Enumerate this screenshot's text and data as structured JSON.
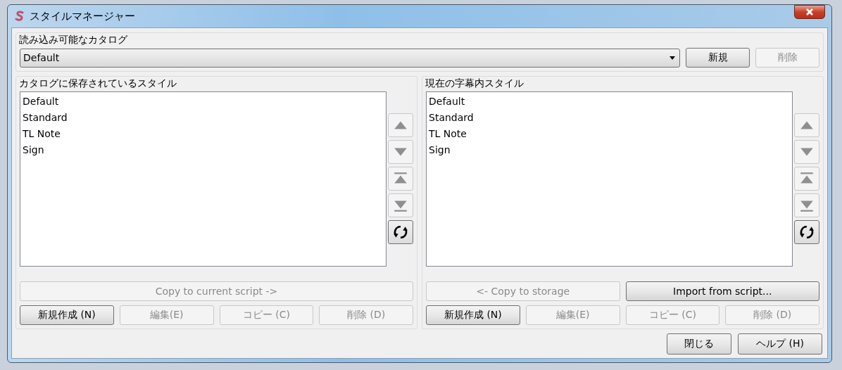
{
  "window": {
    "title": "スタイルマネージャー"
  },
  "catalog": {
    "label": "読み込み可能なカタログ",
    "value": "Default",
    "buttons": [
      {
        "label": "新規",
        "disabled": false
      },
      {
        "label": "削除",
        "disabled": true
      }
    ]
  },
  "panels": [
    {
      "title": "カタログに保存されているスタイル",
      "items": [
        "Default",
        "Standard",
        "TL Note",
        "Sign"
      ],
      "move_buttons": [
        {
          "kind": "up",
          "disabled": true
        },
        {
          "kind": "down",
          "disabled": true
        },
        {
          "kind": "top",
          "disabled": true
        },
        {
          "kind": "bottom",
          "disabled": true
        },
        {
          "kind": "refresh",
          "disabled": false
        }
      ],
      "transfer_buttons": [
        {
          "label": "Copy to current script ->",
          "disabled": true
        }
      ],
      "buttons": [
        {
          "label": "新規作成 (N)",
          "disabled": false
        },
        {
          "label": "編集(E)",
          "disabled": true
        },
        {
          "label": "コピー (C)",
          "disabled": true
        },
        {
          "label": "削除 (D)",
          "disabled": true
        }
      ]
    },
    {
      "title": "現在の字幕内スタイル",
      "items": [
        "Default",
        "Standard",
        "TL Note",
        "Sign"
      ],
      "move_buttons": [
        {
          "kind": "up",
          "disabled": true
        },
        {
          "kind": "down",
          "disabled": true
        },
        {
          "kind": "top",
          "disabled": true
        },
        {
          "kind": "bottom",
          "disabled": true
        },
        {
          "kind": "refresh",
          "disabled": false
        }
      ],
      "transfer_buttons": [
        {
          "label": "<- Copy to storage",
          "disabled": true
        },
        {
          "label": "Import from script...",
          "disabled": false
        }
      ],
      "buttons": [
        {
          "label": "新規作成 (N)",
          "disabled": false
        },
        {
          "label": "編集(E)",
          "disabled": true
        },
        {
          "label": "コピー (C)",
          "disabled": true
        },
        {
          "label": "削除 (D)",
          "disabled": true
        }
      ]
    }
  ],
  "footer_buttons": [
    {
      "label": "閉じる"
    },
    {
      "label": "ヘルプ (H)"
    }
  ]
}
